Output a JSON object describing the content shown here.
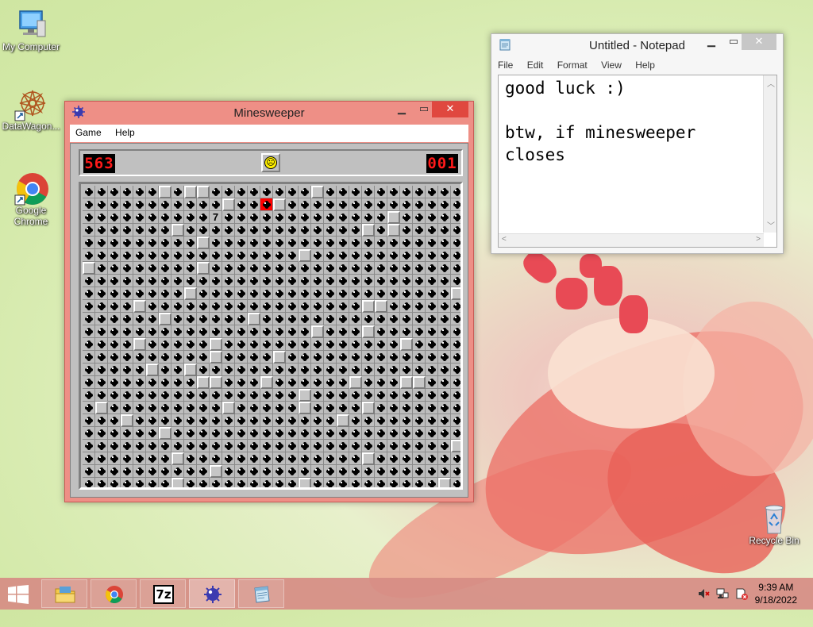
{
  "desktop": {
    "icons": [
      {
        "label": "My Computer"
      },
      {
        "label": "DataWagon..."
      },
      {
        "label": "Google Chrome"
      },
      {
        "label": "Recycle Bin"
      }
    ]
  },
  "minesweeper": {
    "title": "Minesweeper",
    "menu": [
      "Game",
      "Help"
    ],
    "mine_counter": "563",
    "timer": "001",
    "face": "sad",
    "grid_cols": 30,
    "grid_rows": 24,
    "rows": [
      "MMMMMMCMCCMMMMMMMMCMMMMMMMMMMM",
      "MMMMMMMMMMMCMMRCMMMMMMMMMMMMMM",
      "MMMMMMMMMM7MMMMMMMMMMMMMCMMMMM",
      "MMMMMMMCMMMMMMMMMMMMMMCMCMMMMM",
      "MMMMMMMMMCMMMMMMMMMMMMMMMMMMMM",
      "MMMMMMMMMMMMMMMMMCMMMMMMMMMMMM",
      "CMMMMMMMMCMMMMMMMMMMMMMMMMMMMM",
      "MMMMMMMMMMMMMMMMMMMMMMMMMMMMMM",
      "MMMMMMMMCMMMMMMMMMMMMMMMMMMMMC",
      "MMMMCMMMMMMMMMMMMMMMMMCCMMMMMM",
      "MMMMMMCMMMMMMCMMMMMMMMMMMMMMMM",
      "MMMMMMMMMMMMMMMMMMCMMMCMMMMMMM",
      "MMMMCMMMMMCMMMMMMMMMMMMMMCMMMM",
      "MMMMMMMMMMCMMMMCMMMMMMMMMMMMMM",
      "MMMMMCMMCMMMMMMMMMMMMMMMMMMMMM",
      "MMMMMMMMMCCMMMCMMMMMMCMMMCCMMM",
      "MMMMMMMMMMMMMMMMMCMMMMMMMMMMMM",
      "MCMMMMMMMMMCMMMMMCMMMMCMMMMMMM",
      "MMMCMMMMMMMMMMMMMMMMCMMMMMMMMM",
      "MMMMMMCMMMMMMMMMMMMMMMMMMMMMMM",
      "MMMMMMMMMMMMMMMMMMMMMMMMMMMMMC",
      "MMMMMMMCMMMMMMMMMMMMMMCMMMMMMM",
      "MMMMMMMMMMCMMMMMMMMMMMMMMMMMMM",
      "MMMMMMMCMMMMMMMMMCMMMMMMMMMMCM"
    ]
  },
  "notepad": {
    "title": "Untitled - Notepad",
    "menu": [
      "File",
      "Edit",
      "Format",
      "View",
      "Help"
    ],
    "content": "good luck :)\n\nbtw, if minesweeper\ncloses"
  },
  "taskbar": {
    "apps": [
      {
        "name": "file-explorer"
      },
      {
        "name": "chrome"
      },
      {
        "name": "7zip",
        "label": "7z"
      },
      {
        "name": "minesweeper"
      },
      {
        "name": "notepad"
      }
    ],
    "time": "9:39 AM",
    "date": "9/18/2022"
  },
  "colors": {
    "window_frame": "#ee8f86",
    "close_button": "#e0483f",
    "lcd_digits": "#ff1a1a",
    "exploded_mine": "#ff0000"
  }
}
